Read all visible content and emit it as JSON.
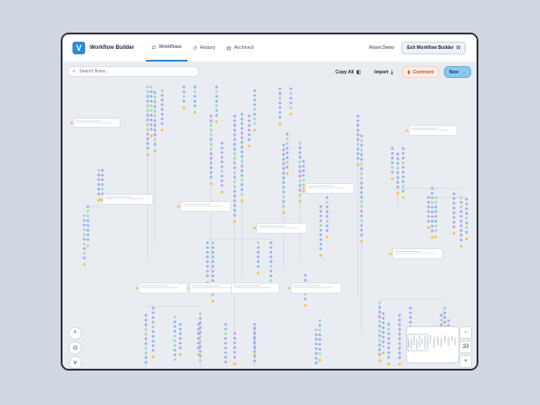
{
  "app": {
    "title": "Workflow Builder",
    "logo_letter": "V",
    "accent": "#2f8bd6"
  },
  "nav": {
    "tabs": [
      {
        "label": "Workflows",
        "icon": "workflow-icon",
        "active": true
      },
      {
        "label": "History",
        "icon": "history-icon",
        "active": false
      },
      {
        "label": "Archived",
        "icon": "archive-icon",
        "active": false
      }
    ],
    "reset_label": "Reset Demo",
    "exit_label": "Exit Workflow Builder"
  },
  "toolbar": {
    "search_placeholder": "Search flows...",
    "copy_all_label": "Copy All",
    "import_label": "Import",
    "comment_label": "Comment",
    "new_label": "New"
  },
  "zoom_controls": {
    "left": [
      "^",
      "⊙",
      "v"
    ],
    "right": [
      "−",
      "33",
      "+"
    ]
  },
  "colors": {
    "dot_blue": "#8fb6ea",
    "dot_purple": "#b9a3e8",
    "dot_green": "#9fdcb4",
    "dot_yellow": "#f2c14e",
    "canvas": "#e9edf2"
  }
}
